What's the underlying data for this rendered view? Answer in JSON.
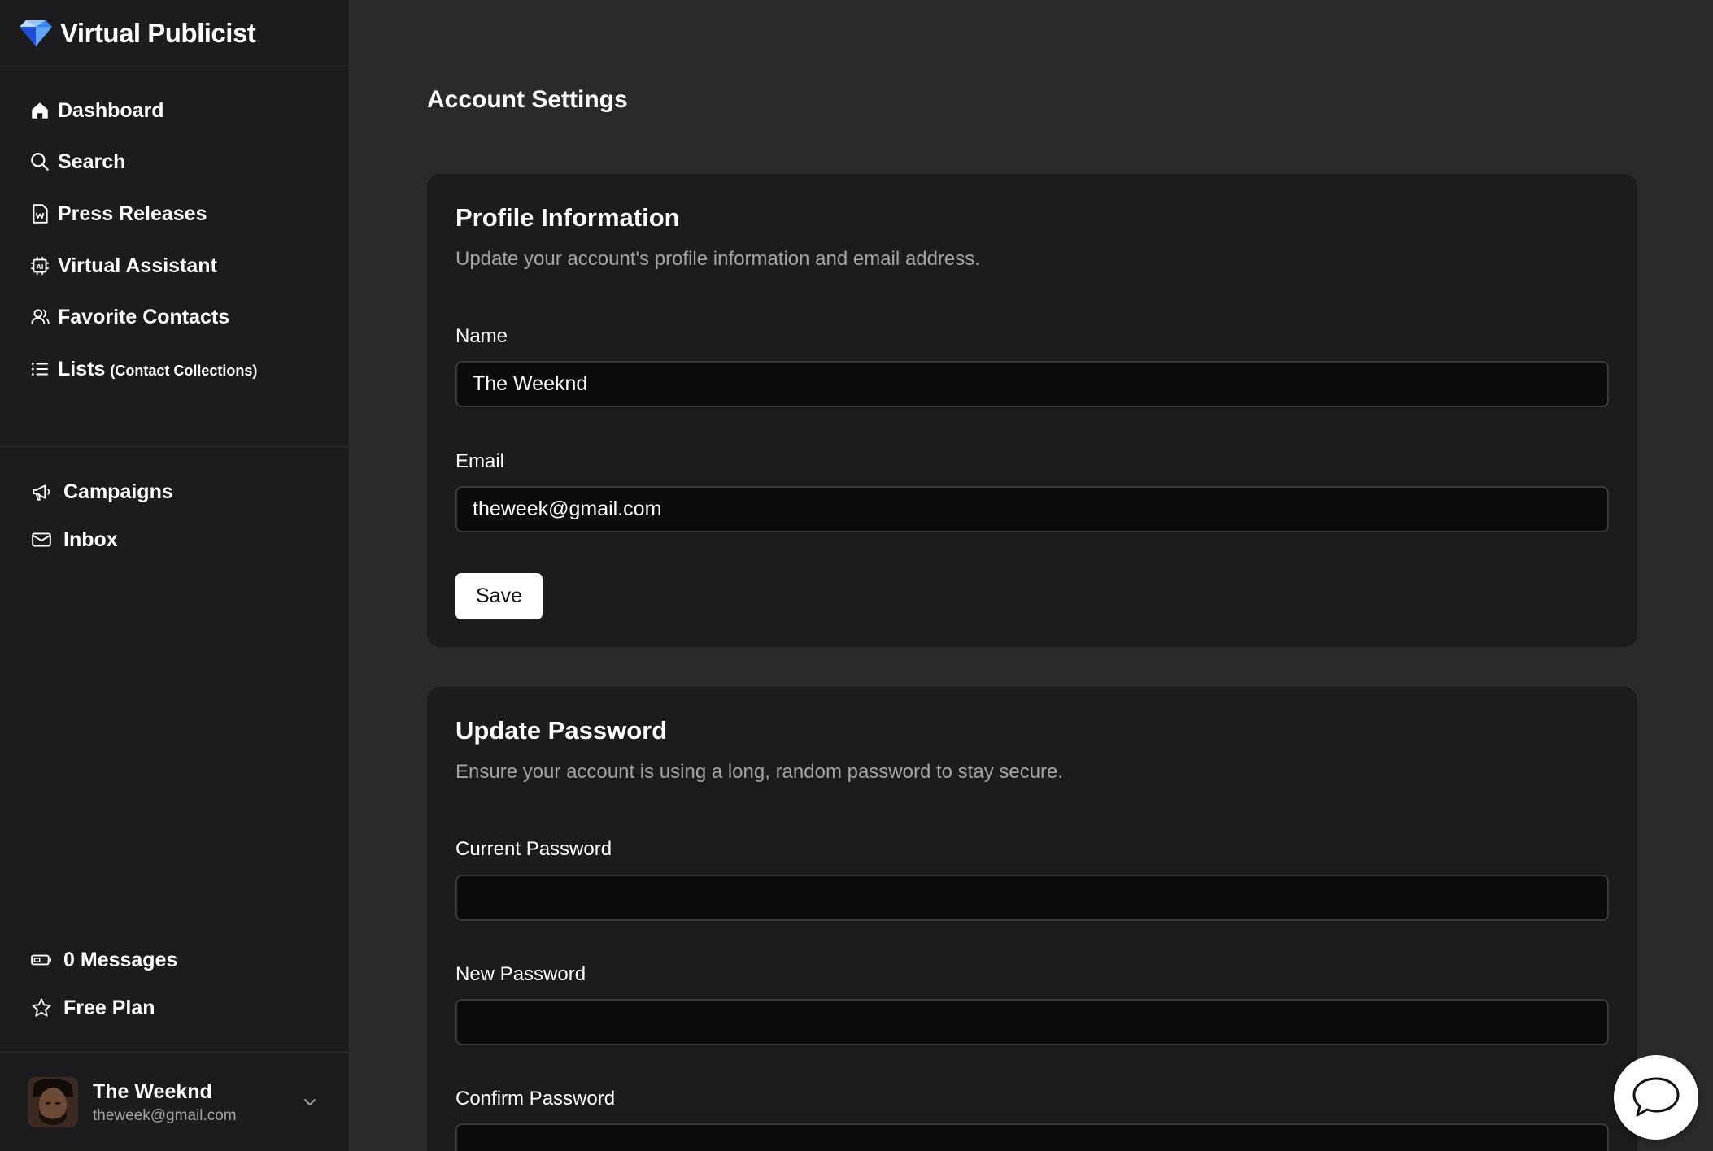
{
  "brand": {
    "name": "Virtual Publicist"
  },
  "nav": {
    "primary": [
      {
        "label": "Dashboard",
        "icon": "home-icon"
      },
      {
        "label": "Search",
        "icon": "search-icon"
      },
      {
        "label": "Press Releases",
        "icon": "document-w-icon"
      },
      {
        "label": "Virtual Assistant",
        "icon": "ai-chip-icon"
      },
      {
        "label": "Favorite Contacts",
        "icon": "users-icon"
      },
      {
        "label": "Lists",
        "sublabel": "(Contact Collections)",
        "icon": "list-icon"
      }
    ],
    "secondary": [
      {
        "label": "Campaigns",
        "icon": "megaphone-icon"
      },
      {
        "label": "Inbox",
        "icon": "envelope-icon"
      }
    ],
    "bottom": [
      {
        "label": "0 Messages",
        "icon": "battery-icon"
      },
      {
        "label": "Free Plan",
        "icon": "star-icon"
      }
    ]
  },
  "user": {
    "name": "The Weeknd",
    "email": "theweek@gmail.com"
  },
  "page": {
    "title": "Account Settings"
  },
  "profile": {
    "title": "Profile Information",
    "description": "Update your account's profile information and email address.",
    "name_label": "Name",
    "name_value": "The Weeknd",
    "email_label": "Email",
    "email_value": "theweek@gmail.com",
    "save_label": "Save"
  },
  "password": {
    "title": "Update Password",
    "description": "Ensure your account is using a long, random password to stay secure.",
    "current_label": "Current Password",
    "current_value": "",
    "new_label": "New Password",
    "new_value": "",
    "confirm_label": "Confirm Password",
    "confirm_value": ""
  },
  "colors": {
    "background": "#2a2a2d",
    "sidebar": "#1c1c1e",
    "card": "#1c1c1e",
    "input": "#0c0c0e",
    "muted_text": "#a3a3a8",
    "brand_blue": "#3b82f6"
  }
}
